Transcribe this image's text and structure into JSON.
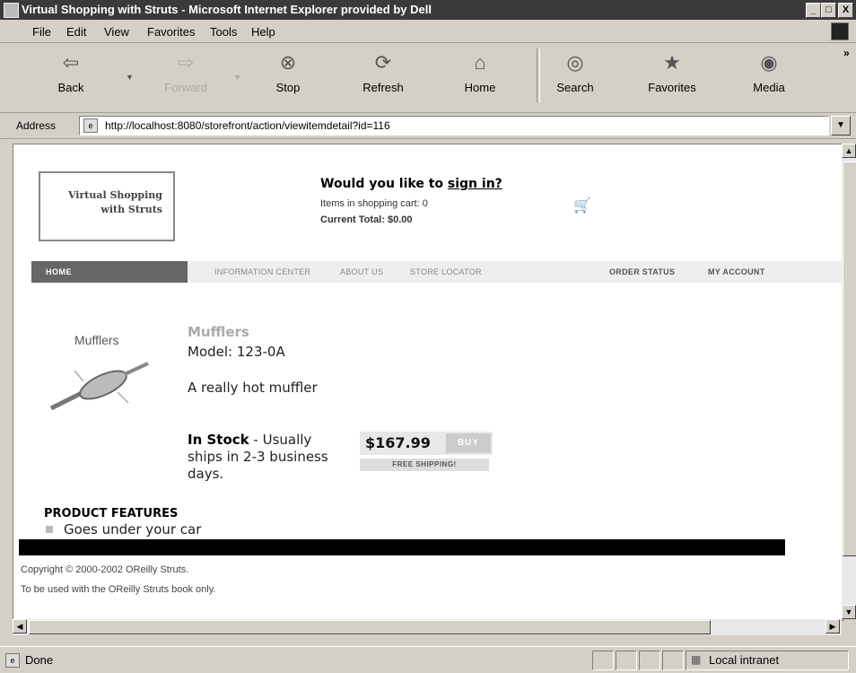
{
  "window": {
    "title": "Virtual Shopping with Struts - Microsoft Internet Explorer provided by Dell",
    "min": "_",
    "max": "□",
    "close": "X"
  },
  "menu": [
    {
      "label": "File"
    },
    {
      "label": "Edit"
    },
    {
      "label": "View"
    },
    {
      "label": "Favorites"
    },
    {
      "label": "Tools"
    },
    {
      "label": "Help"
    }
  ],
  "toolbar": {
    "back": "Back",
    "forward": "Forward",
    "stop": "Stop",
    "refresh": "Refresh",
    "home": "Home",
    "search": "Search",
    "favorites": "Favorites",
    "media": "Media",
    "more": "»"
  },
  "address": {
    "label": "Address",
    "url": "http://localhost:8080/storefront/action/viewitemdetail?id=116"
  },
  "page": {
    "logo": {
      "line1": "Virtual Shopping",
      "line2": "with Struts"
    },
    "greeting_prefix": "Would you like to ",
    "greeting_link": "sign in?",
    "cart_items": "Items in shopping cart: 0",
    "cart_total": "Current Total: $0.00",
    "nav": {
      "home": "HOME",
      "info": "INFORMATION CENTER",
      "about": "ABOUT US",
      "store": "STORE LOCATOR",
      "order": "ORDER STATUS",
      "account": "MY ACCOUNT"
    },
    "product": {
      "image_label": "Mufflers",
      "name": "Mufflers",
      "model": "Model: 123-0A",
      "description": "A really hot muffler",
      "stock_bold": "In Stock",
      "stock_rest": " - Usually ships in 2-3 business days.",
      "price": "$167.99",
      "buy": "BUY",
      "shipping": "FREE SHIPPING!"
    },
    "features_title": "PRODUCT FEATURES",
    "features": [
      "Goes under your car"
    ],
    "copyright1": "Copyright © 2000-2002 OReilly Struts.",
    "copyright2": "To be used with the OReilly Struts book only."
  },
  "status": {
    "text": "Done",
    "zone": "Local intranet"
  }
}
